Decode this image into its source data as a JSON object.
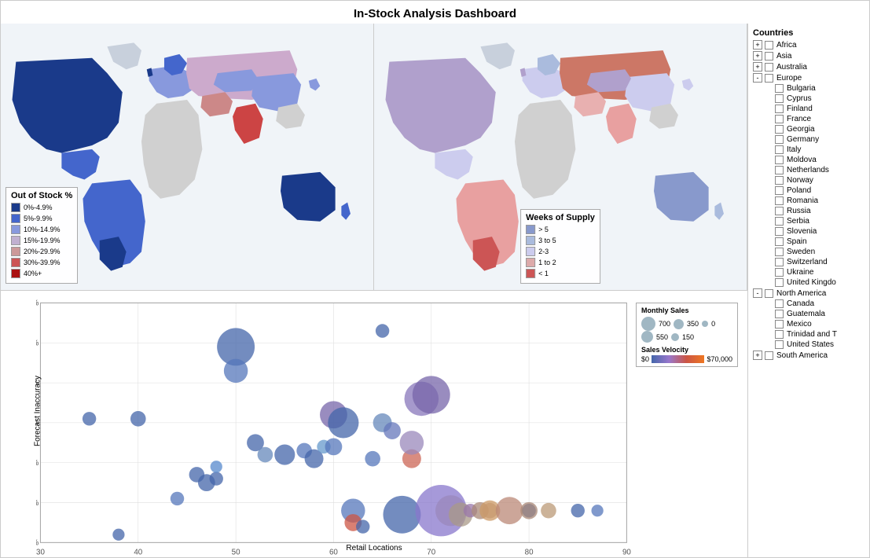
{
  "title": "In-Stock Analysis Dashboard",
  "maps": {
    "left_legend_title": "Out of Stock %",
    "left_legend_items": [
      {
        "label": "0%-4.9%",
        "color": "#1a3a8a"
      },
      {
        "label": "5%-9.9%",
        "color": "#4466cc"
      },
      {
        "label": "10%-14.9%",
        "color": "#8899dd"
      },
      {
        "label": "15%-19.9%",
        "color": "#c0b0d0"
      },
      {
        "label": "20%-29.9%",
        "color": "#cc9999"
      },
      {
        "label": "30%-39.9%",
        "color": "#cc5555"
      },
      {
        "label": "40%+",
        "color": "#aa1111"
      }
    ],
    "right_legend_title": "Weeks of Supply",
    "right_legend_items": [
      {
        "label": "> 5",
        "color": "#8899cc"
      },
      {
        "label": "3 to 5",
        "color": "#aabbdd"
      },
      {
        "label": "2-3",
        "color": "#ccccee"
      },
      {
        "label": "1 to 2",
        "color": "#ddaaaa"
      },
      {
        "label": "< 1",
        "color": "#cc5555"
      }
    ]
  },
  "scatter": {
    "title": "",
    "x_label": "Retail Locations",
    "y_label": "Forecast Inaccuracy",
    "x_min": 30,
    "x_max": 90,
    "y_min": "0%",
    "y_max": "60%",
    "x_ticks": [
      30,
      40,
      50,
      60,
      70,
      80,
      90
    ],
    "y_ticks": [
      "0%",
      "10%",
      "20%",
      "30%",
      "40%",
      "50%",
      "60%"
    ],
    "legend": {
      "monthly_sales_title": "Monthly Sales",
      "monthly_sales_values": [
        "700",
        "350",
        "0",
        "550",
        "150"
      ],
      "velocity_title": "Sales Velocity",
      "velocity_min": "$0",
      "velocity_max": "$70,000"
    }
  },
  "sidebar": {
    "title": "Countries",
    "items": [
      {
        "type": "parent",
        "toggle": "+",
        "label": "Africa"
      },
      {
        "type": "parent",
        "toggle": "+",
        "label": "Asia"
      },
      {
        "type": "parent",
        "toggle": "+",
        "label": "Australia"
      },
      {
        "type": "parent",
        "toggle": "-",
        "label": "Europe"
      },
      {
        "type": "child",
        "label": "Bulgaria"
      },
      {
        "type": "child",
        "label": "Cyprus"
      },
      {
        "type": "child",
        "label": "Finland"
      },
      {
        "type": "child",
        "label": "France"
      },
      {
        "type": "child",
        "label": "Georgia"
      },
      {
        "type": "child",
        "label": "Germany"
      },
      {
        "type": "child",
        "label": "Italy"
      },
      {
        "type": "child",
        "label": "Moldova"
      },
      {
        "type": "child",
        "label": "Netherlands"
      },
      {
        "type": "child",
        "label": "Norway"
      },
      {
        "type": "child",
        "label": "Poland"
      },
      {
        "type": "child",
        "label": "Romania"
      },
      {
        "type": "child",
        "label": "Russia"
      },
      {
        "type": "child",
        "label": "Serbia"
      },
      {
        "type": "child",
        "label": "Slovenia"
      },
      {
        "type": "child",
        "label": "Spain"
      },
      {
        "type": "child",
        "label": "Sweden"
      },
      {
        "type": "child",
        "label": "Switzerland"
      },
      {
        "type": "child",
        "label": "Ukraine"
      },
      {
        "type": "child",
        "label": "United Kingdo"
      },
      {
        "type": "parent",
        "toggle": "-",
        "label": "North America"
      },
      {
        "type": "child",
        "label": "Canada"
      },
      {
        "type": "child",
        "label": "Guatemala"
      },
      {
        "type": "child",
        "label": "Mexico"
      },
      {
        "type": "child",
        "label": "Trinidad and T"
      },
      {
        "type": "child",
        "label": "United States"
      },
      {
        "type": "parent",
        "toggle": "+",
        "label": "South America"
      }
    ]
  }
}
